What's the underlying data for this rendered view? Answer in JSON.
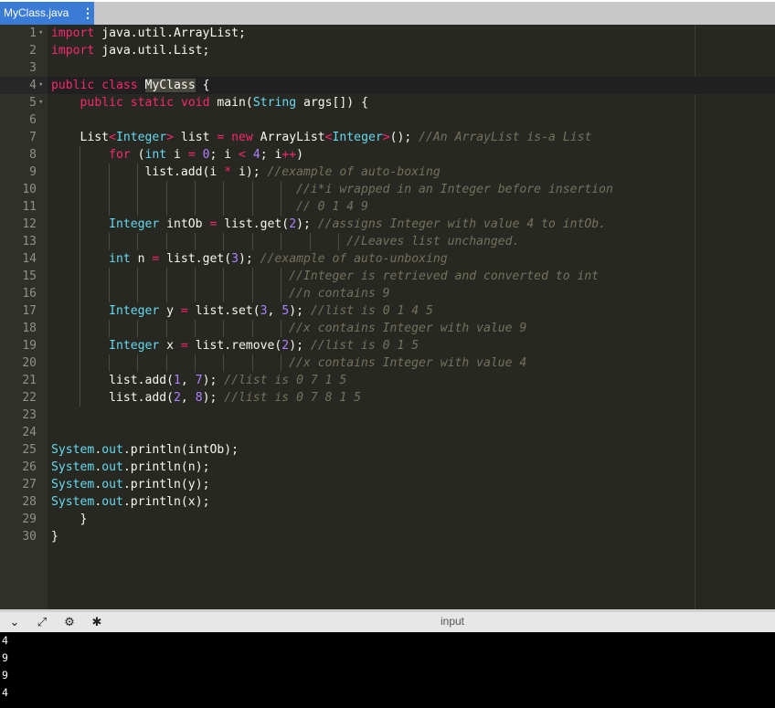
{
  "tab": {
    "filename": "MyClass.java",
    "menu_icon": "vertical-dots-icon"
  },
  "editor": {
    "gutter_numbers": [
      "1",
      "2",
      "3",
      "4",
      "5",
      "6",
      "7",
      "8",
      "9",
      "10",
      "11",
      "12",
      "13",
      "14",
      "15",
      "16",
      "17",
      "18",
      "19",
      "20",
      "21",
      "22",
      "23",
      "24",
      "25",
      "26",
      "27",
      "28",
      "29",
      "30"
    ],
    "fold_marker_lines": [
      1,
      4,
      5
    ],
    "active_line": 4,
    "lines": [
      [
        [
          "k",
          "import"
        ],
        [
          "p",
          " java.util.ArrayList;"
        ]
      ],
      [
        [
          "k",
          "import"
        ],
        [
          "p",
          " java.util.List;"
        ]
      ],
      [],
      [
        [
          "k",
          "public"
        ],
        [
          "p",
          " "
        ],
        [
          "k",
          "class"
        ],
        [
          "p",
          " "
        ],
        [
          "hl",
          "MyClass"
        ],
        [
          "p",
          " {"
        ]
      ],
      [
        [
          "p",
          "    "
        ],
        [
          "k",
          "public"
        ],
        [
          "p",
          " "
        ],
        [
          "k",
          "static"
        ],
        [
          "p",
          " "
        ],
        [
          "k",
          "void"
        ],
        [
          "p",
          " main("
        ],
        [
          "s",
          "String"
        ],
        [
          "p",
          " args[]) {"
        ]
      ],
      [],
      [
        [
          "p",
          "    List"
        ],
        [
          "k",
          "<"
        ],
        [
          "s",
          "Integer"
        ],
        [
          "k",
          ">"
        ],
        [
          "p",
          " list "
        ],
        [
          "k",
          "="
        ],
        [
          "p",
          " "
        ],
        [
          "k",
          "new"
        ],
        [
          "p",
          " ArrayList"
        ],
        [
          "k",
          "<"
        ],
        [
          "s",
          "Integer"
        ],
        [
          "k",
          ">"
        ],
        [
          "p",
          "(); "
        ],
        [
          "c",
          "//An ArrayList is-a List"
        ]
      ],
      [
        [
          "p",
          "        "
        ],
        [
          "k",
          "for"
        ],
        [
          "p",
          " ("
        ],
        [
          "s",
          "int"
        ],
        [
          "p",
          " i "
        ],
        [
          "k",
          "="
        ],
        [
          "p",
          " "
        ],
        [
          "n",
          "0"
        ],
        [
          "p",
          "; i "
        ],
        [
          "k",
          "<"
        ],
        [
          "p",
          " "
        ],
        [
          "n",
          "4"
        ],
        [
          "p",
          "; i"
        ],
        [
          "k",
          "++"
        ],
        [
          "p",
          ")"
        ]
      ],
      [
        [
          "p",
          "             list.add(i "
        ],
        [
          "k",
          "*"
        ],
        [
          "p",
          " i); "
        ],
        [
          "c",
          "//example of auto-boxing"
        ]
      ],
      [
        [
          "p",
          "                                  "
        ],
        [
          "c",
          "//i*i wrapped in an Integer before insertion"
        ]
      ],
      [
        [
          "p",
          "                                  "
        ],
        [
          "c",
          "// 0 1 4 9"
        ]
      ],
      [
        [
          "p",
          "        "
        ],
        [
          "s",
          "Integer"
        ],
        [
          "p",
          " intOb "
        ],
        [
          "k",
          "="
        ],
        [
          "p",
          " list.get("
        ],
        [
          "n",
          "2"
        ],
        [
          "p",
          "); "
        ],
        [
          "c",
          "//assigns Integer with value 4 to intOb."
        ]
      ],
      [
        [
          "p",
          "                                         "
        ],
        [
          "c",
          "//Leaves list unchanged."
        ]
      ],
      [
        [
          "p",
          "        "
        ],
        [
          "s",
          "int"
        ],
        [
          "p",
          " n "
        ],
        [
          "k",
          "="
        ],
        [
          "p",
          " list.get("
        ],
        [
          "n",
          "3"
        ],
        [
          "p",
          "); "
        ],
        [
          "c",
          "//example of auto-unboxing"
        ]
      ],
      [
        [
          "p",
          "                                 "
        ],
        [
          "c",
          "//Integer is retrieved and converted to int"
        ]
      ],
      [
        [
          "p",
          "                                 "
        ],
        [
          "c",
          "//n contains 9"
        ]
      ],
      [
        [
          "p",
          "        "
        ],
        [
          "s",
          "Integer"
        ],
        [
          "p",
          " y "
        ],
        [
          "k",
          "="
        ],
        [
          "p",
          " list.set("
        ],
        [
          "n",
          "3"
        ],
        [
          "p",
          ", "
        ],
        [
          "n",
          "5"
        ],
        [
          "p",
          "); "
        ],
        [
          "c",
          "//list is 0 1 4 5"
        ]
      ],
      [
        [
          "p",
          "                                 "
        ],
        [
          "c",
          "//x contains Integer with value 9"
        ]
      ],
      [
        [
          "p",
          "        "
        ],
        [
          "s",
          "Integer"
        ],
        [
          "p",
          " x "
        ],
        [
          "k",
          "="
        ],
        [
          "p",
          " list.remove("
        ],
        [
          "n",
          "2"
        ],
        [
          "p",
          "); "
        ],
        [
          "c",
          "//list is 0 1 5"
        ]
      ],
      [
        [
          "p",
          "                                 "
        ],
        [
          "c",
          "//x contains Integer with value 4"
        ]
      ],
      [
        [
          "p",
          "        list.add("
        ],
        [
          "n",
          "1"
        ],
        [
          "p",
          ", "
        ],
        [
          "n",
          "7"
        ],
        [
          "p",
          "); "
        ],
        [
          "c",
          "//list is 0 7 1 5"
        ]
      ],
      [
        [
          "p",
          "        list.add("
        ],
        [
          "n",
          "2"
        ],
        [
          "p",
          ", "
        ],
        [
          "n",
          "8"
        ],
        [
          "p",
          "); "
        ],
        [
          "c",
          "//list is 0 7 8 1 5"
        ]
      ],
      [],
      [],
      [
        [
          "s",
          "System"
        ],
        [
          "p",
          "."
        ],
        [
          "s",
          "out"
        ],
        [
          "p",
          ".println(intOb);"
        ]
      ],
      [
        [
          "s",
          "System"
        ],
        [
          "p",
          "."
        ],
        [
          "s",
          "out"
        ],
        [
          "p",
          ".println(n);"
        ]
      ],
      [
        [
          "s",
          "System"
        ],
        [
          "p",
          "."
        ],
        [
          "s",
          "out"
        ],
        [
          "p",
          ".println(y);"
        ]
      ],
      [
        [
          "s",
          "System"
        ],
        [
          "p",
          "."
        ],
        [
          "s",
          "out"
        ],
        [
          "p",
          ".println(x);"
        ]
      ],
      [
        [
          "p",
          "    }"
        ]
      ],
      [
        [
          "p",
          "}"
        ]
      ]
    ]
  },
  "toolbar": {
    "icons": [
      "chevron-down-icon",
      "expand-icon",
      "gear-icon",
      "debug-icon"
    ],
    "input_label": "input"
  },
  "console": {
    "output_lines": [
      "4",
      "9",
      "9",
      "4"
    ]
  },
  "colors": {
    "tab_bg": "#3a7bd5",
    "editor_bg": "#272822",
    "gutter_bg": "#2f3129",
    "keyword": "#f92672",
    "type": "#66d9ef",
    "number": "#ae81ff",
    "comment": "#75715e",
    "console_bg": "#000000"
  }
}
